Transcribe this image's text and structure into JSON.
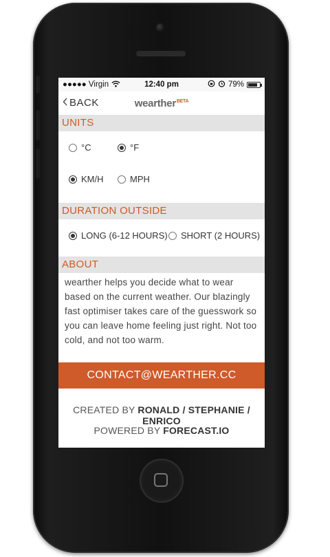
{
  "status_bar": {
    "carrier": "●●●●● Virgin",
    "time": "12:40 pm",
    "battery_text": "79%",
    "battery_level": 0.79
  },
  "nav": {
    "back_label": "BACK",
    "brand": "wearther",
    "beta": "BETA"
  },
  "units": {
    "title": "UNITS",
    "temperature": [
      {
        "label": "°C",
        "selected": false
      },
      {
        "label": "°F",
        "selected": true
      }
    ],
    "speed": [
      {
        "label": "KM/H",
        "selected": true
      },
      {
        "label": "MPH",
        "selected": false
      }
    ]
  },
  "duration": {
    "title": "DURATION OUTSIDE",
    "options": [
      {
        "label": "LONG (6-12 HOURS)",
        "selected": true
      },
      {
        "label": "SHORT (2 HOURS)",
        "selected": false
      }
    ]
  },
  "about": {
    "title": "ABOUT",
    "text": "wearther helps you decide what to wear based on the current weather. Our blazingly fast optimiser takes care of the guesswork so you can leave home feeling just right. Not too cold, and not too warm."
  },
  "contact": {
    "label": "CONTACT@WEARTHER.CC"
  },
  "credits": {
    "created_prefix": "CREATED BY",
    "authors": "RONALD / STEPHANIE / ENRICO",
    "powered_prefix": "POWERED BY",
    "powered_by": "FORECAST.IO"
  },
  "colors": {
    "accent": "#cf5a2a",
    "section_bg": "#e3e3e3"
  },
  "icons": {
    "back": "chevron-left-icon",
    "wifi": "wifi-icon",
    "alarm": "alarm-icon",
    "rotation_lock": "rotation-lock-icon",
    "battery": "battery-icon"
  }
}
